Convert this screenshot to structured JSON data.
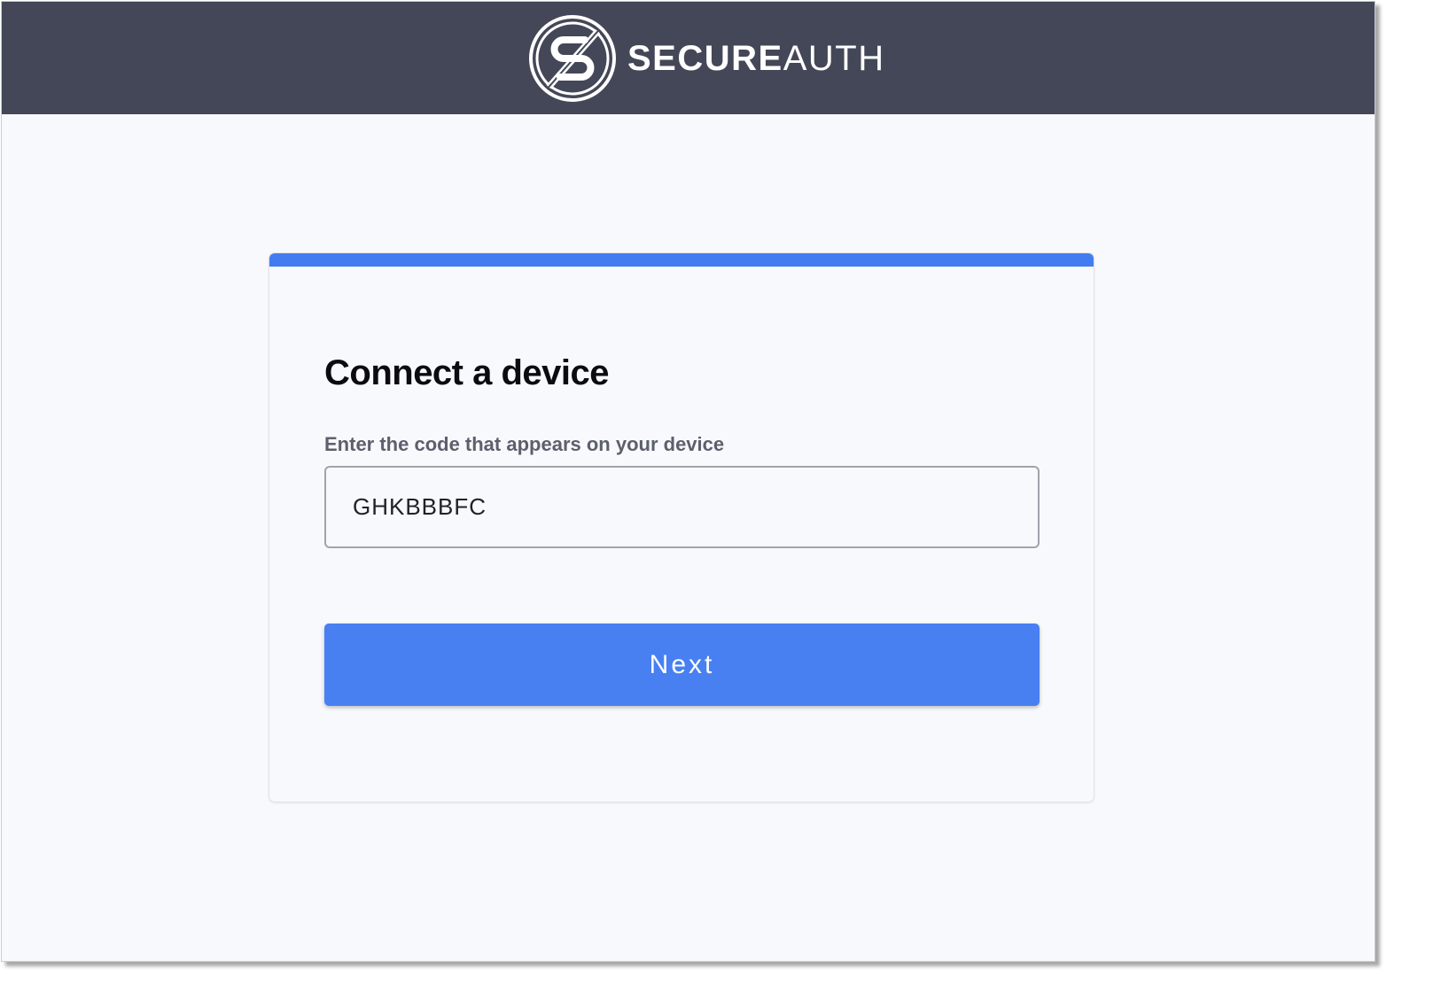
{
  "header": {
    "brand_bold": "SECURE",
    "brand_light": "AUTH",
    "background_color": "#444757",
    "logo_icon": "secureauth-s-logo-icon"
  },
  "card": {
    "accent_color": "#437cf0",
    "title": "Connect a device",
    "code_field": {
      "label": "Enter the code that appears on your device",
      "value": "GHKBBBFC"
    },
    "next_button": {
      "label": "Next",
      "color": "#4880f2"
    }
  }
}
